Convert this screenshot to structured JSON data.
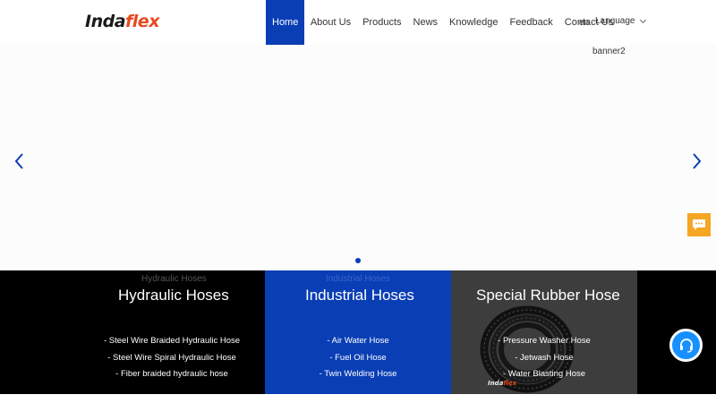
{
  "header": {
    "logo_part1": "Inda",
    "logo_part2": "flex",
    "nav": [
      {
        "label": "Home",
        "active": true
      },
      {
        "label": "About Us"
      },
      {
        "label": "Products"
      },
      {
        "label": "News"
      },
      {
        "label": "Knowledge"
      },
      {
        "label": "Feedback"
      },
      {
        "label": "Contact Us"
      }
    ],
    "lang_code": "en",
    "language_label": "Language"
  },
  "banner": {
    "image_alt": "banner2",
    "slide_count_shown": 1
  },
  "categories": [
    {
      "alt": "Hydraulic Hoses",
      "title": "Hydraulic Hoses",
      "links": [
        "- Steel Wire Braided Hydraulic Hose",
        "- Steel Wire Spiral Hydraulic Hose",
        "- Fiber braided hydraulic hose"
      ]
    },
    {
      "alt": "Industrial Hoses",
      "title": "Industrial Hoses",
      "links": [
        "- Air Water Hose",
        "- Fuel Oil Hose",
        "- Twin Welding Hose"
      ]
    },
    {
      "alt": "",
      "title": "Special Rubber Hose",
      "links": [
        "- Pressure Washer Hose",
        "- Jetwash Hose",
        "- Water Blasting Hose"
      ],
      "image_logo_part1": "Inda",
      "image_logo_part2": "flex"
    }
  ],
  "colors": {
    "brand_blue": "#0a3eb5",
    "logo_orange": "#e8491d",
    "chat_orange": "#f5a623",
    "service_blue": "#1890ff"
  },
  "icons": {
    "prev": "chevron-left-icon",
    "next": "chevron-right-icon",
    "chat": "chat-bubble-icon",
    "service": "headset-icon"
  }
}
